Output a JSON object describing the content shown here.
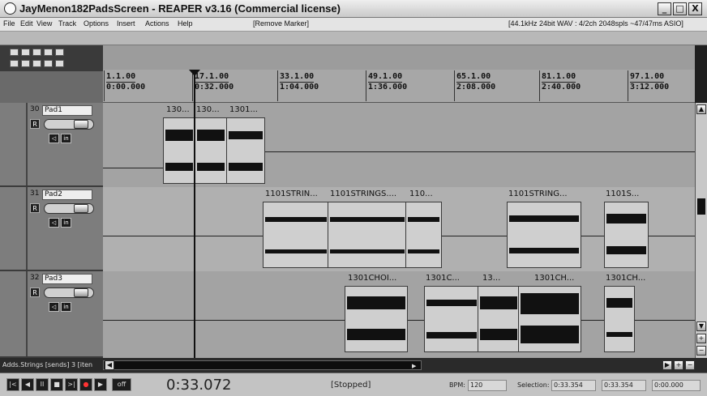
{
  "window": {
    "title": "JayMenon182PadsScreen - REAPER v3.16 (Commercial license)",
    "controls": [
      "_",
      "□",
      "X"
    ]
  },
  "menu": {
    "items": [
      "File",
      "Edit",
      "View",
      "Track",
      "Options",
      "Insert",
      "Actions",
      "Help"
    ],
    "remove_marker": "[Remove Marker]",
    "audio_status": "[44.1kHz 24bit WAV : 4/2ch 2048spls ~47/47ms ASIO]"
  },
  "ruler": [
    {
      "bar": "1.1.00",
      "time": "0:00.000"
    },
    {
      "bar": "17.1.00",
      "time": "0:32.000"
    },
    {
      "bar": "33.1.00",
      "time": "1:04.000"
    },
    {
      "bar": "49.1.00",
      "time": "1:36.000"
    },
    {
      "bar": "65.1.00",
      "time": "2:08.000"
    },
    {
      "bar": "81.1.00",
      "time": "2:40.000"
    },
    {
      "bar": "97.1.00",
      "time": "3:12.000"
    }
  ],
  "tracks": [
    {
      "number": "30",
      "name": "Pad1",
      "rec_label": "R",
      "fx_label": "in"
    },
    {
      "number": "31",
      "name": "Pad2",
      "rec_label": "R",
      "fx_label": "in"
    },
    {
      "number": "32",
      "name": "Pad3",
      "rec_label": "R",
      "fx_label": "in"
    }
  ],
  "items": {
    "track1": [
      "130...",
      "130...",
      "1301..."
    ],
    "track2": [
      "1101STRIN...",
      "1101STRINGS....",
      "110...",
      "1101STRING...",
      "1101S..."
    ],
    "track3": [
      "1301CHOI...",
      "1301C...",
      "13...",
      "1301CH...",
      "1301CH..."
    ]
  },
  "bottom_track_label": "Adds.Strings [sends] 3 [iten",
  "transport": {
    "buttons": [
      "|<",
      "◀",
      "II",
      "■",
      ">|",
      "●",
      "▶",
      "off"
    ],
    "time": "0:33.072",
    "state": "[Stopped]",
    "bpm_label": "BPM:",
    "bpm": "120",
    "selection_label": "Selection:",
    "sel_start": "0:33.354",
    "sel_end": "0:33.354",
    "sel_length": "0:00.000"
  }
}
